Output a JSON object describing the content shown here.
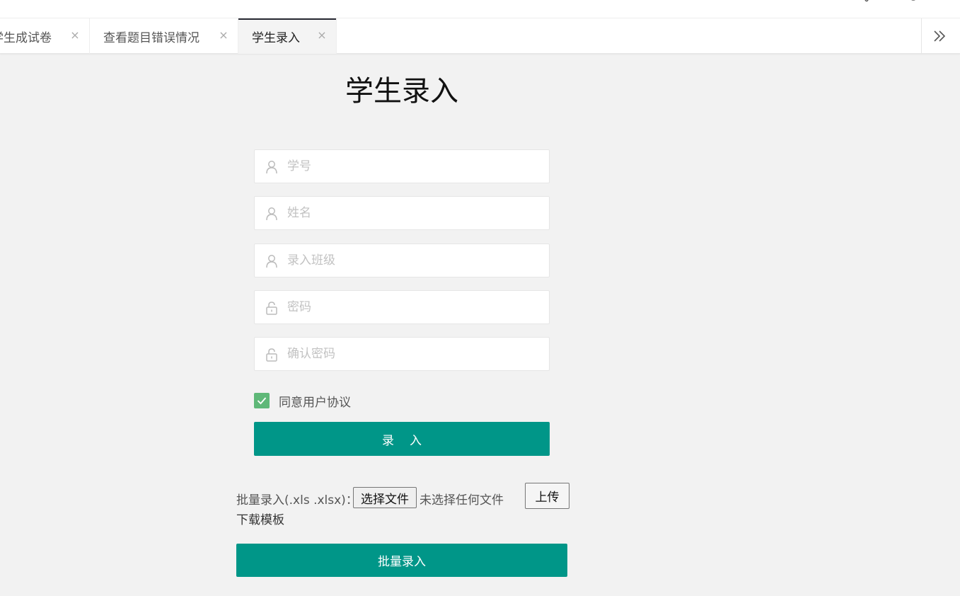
{
  "tabs": [
    {
      "label": "学生成试卷",
      "active": false
    },
    {
      "label": "查看题目错误情况",
      "active": false
    },
    {
      "label": "学生录入",
      "active": true
    }
  ],
  "tab_close_glyph": "×",
  "form": {
    "title": "学生录入",
    "fields": [
      {
        "name": "student-id",
        "placeholder": "学号",
        "icon": "user-icon"
      },
      {
        "name": "student-name",
        "placeholder": "姓名",
        "icon": "user-icon"
      },
      {
        "name": "class",
        "placeholder": "录入班级",
        "icon": "user-icon"
      },
      {
        "name": "password",
        "placeholder": "密码",
        "icon": "lock-icon"
      },
      {
        "name": "confirm-password",
        "placeholder": "确认密码",
        "icon": "lock-icon"
      }
    ],
    "agree_label": "同意用户协议",
    "agree_checked": true,
    "submit_label": "录入"
  },
  "batch": {
    "label": "批量录入(.xls .xlsx)：",
    "file_button_label": "选择文件",
    "file_status": "未选择任何文件",
    "upload_label": "上传",
    "download_label": "下载模板",
    "submit_label": "批量录入"
  },
  "colors": {
    "primary": "#009688",
    "checkbox": "#5fb878",
    "background": "#f2f2f2"
  }
}
